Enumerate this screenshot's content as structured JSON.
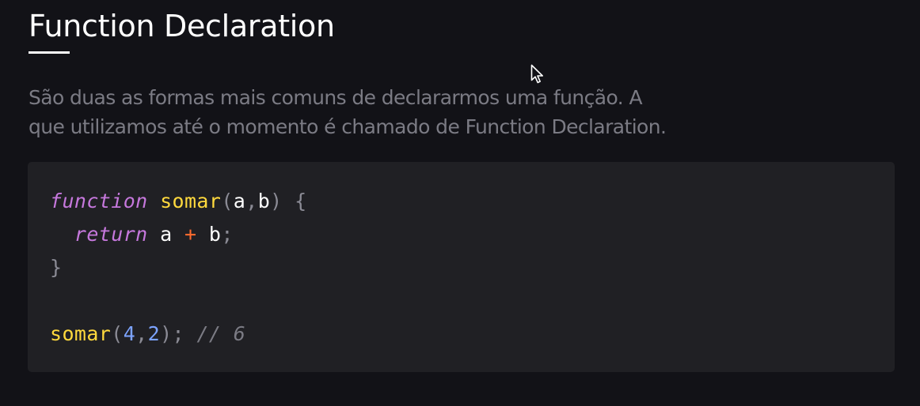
{
  "section": {
    "title": "Function Declaration",
    "intro_line1": "São duas as formas mais comuns de declararmos uma função. A",
    "intro_line2": "que utilizamos até o momento é chamado de Function Declaration."
  },
  "code": {
    "line1": {
      "keyword": "function",
      "name": "somar",
      "open_paren": "(",
      "param_a": "a",
      "comma": ",",
      "param_b": "b",
      "close_paren": ")",
      "brace_open": "{"
    },
    "line2": {
      "keyword": "return",
      "var_a": "a",
      "operator": "+",
      "var_b": "b",
      "semicolon": ";"
    },
    "line3": {
      "brace_close": "}"
    },
    "line5": {
      "name": "somar",
      "open_paren": "(",
      "arg1": "4",
      "comma": ",",
      "arg2": "2",
      "close_paren": ")",
      "semicolon": ";",
      "comment": "// 6"
    }
  },
  "colors": {
    "background": "#121217",
    "code_background": "#202024",
    "keyword": "#c678dd",
    "function_name": "#ffd93d",
    "operator": "#ff6a2e",
    "number": "#7ca3ff",
    "comment": "#7b7b84"
  },
  "icons": {
    "cursor": "mouse-pointer-icon"
  }
}
